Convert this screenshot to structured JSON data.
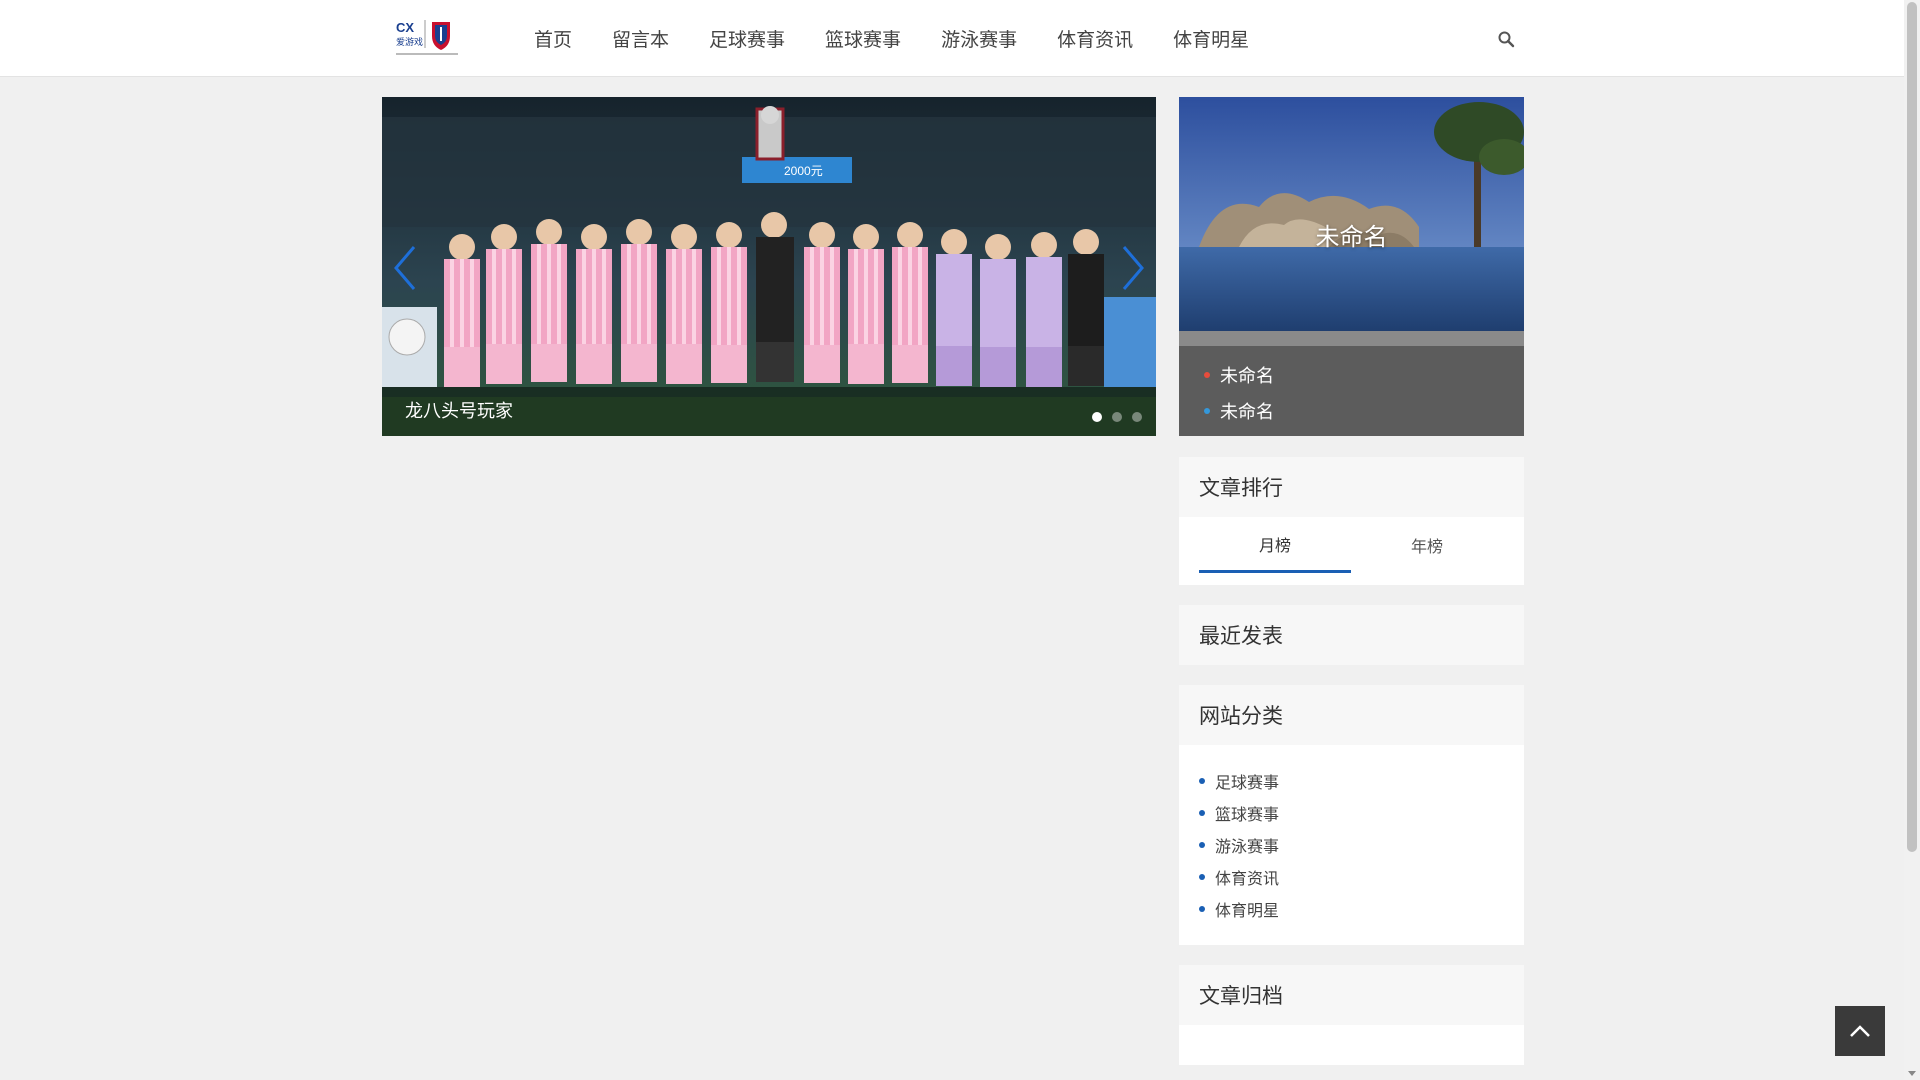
{
  "header": {
    "logo_alt": "爱游戏",
    "nav": [
      "首页",
      "留言本",
      "足球赛事",
      "篮球赛事",
      "游泳赛事",
      "体育资讯",
      "体育明星"
    ]
  },
  "slider": {
    "caption": "龙八头号玩家",
    "total_slides": 3,
    "active_slide": 1,
    "banner_text": "2000元"
  },
  "feature": {
    "title": "未命名",
    "links": [
      {
        "label": "未命名",
        "bullet_color": "#e74c3c"
      },
      {
        "label": "未命名",
        "bullet_color": "#3498db"
      }
    ]
  },
  "widgets": {
    "ranking": {
      "title": "文章排行",
      "tabs": [
        "月榜",
        "年榜"
      ],
      "active_tab": 0
    },
    "recent": {
      "title": "最近发表"
    },
    "categories": {
      "title": "网站分类",
      "items": [
        "足球赛事",
        "篮球赛事",
        "游泳赛事",
        "体育资讯",
        "体育明星"
      ]
    },
    "archive": {
      "title": "文章归档"
    }
  },
  "colors": {
    "accent": "#1a5fb4",
    "page_bg": "#f0f0f0",
    "widget_head_bg": "#f7f7f7",
    "back_top_bg": "#3a3a3a"
  },
  "icons": {
    "search": "search-icon",
    "slide_prev": "chevron-left-icon",
    "slide_next": "chevron-right-icon",
    "back_to_top": "chevron-up-icon"
  }
}
